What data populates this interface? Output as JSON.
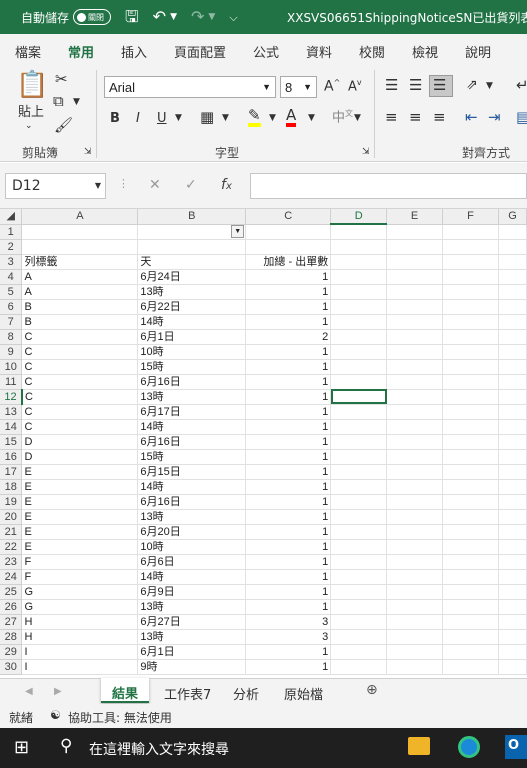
{
  "titlebar": {
    "autosave_label": "自動儲存",
    "toggle_state": "關閉",
    "filename": "XXSVS06651ShippingNoticeSN已出貨列表"
  },
  "tabs": [
    "檔案",
    "常用",
    "插入",
    "頁面配置",
    "公式",
    "資料",
    "校閱",
    "檢視",
    "說明"
  ],
  "active_tab": "常用",
  "ribbon": {
    "paste_label": "貼上",
    "clipboard_label": "剪貼簿",
    "font_name": "Arial",
    "font_size": "8",
    "font_group_label": "字型",
    "align_group_label": "對齊方式",
    "bold": "B",
    "italic": "I",
    "underline": "U",
    "highlight_color": "#ffff00",
    "font_color": "#ff0000"
  },
  "formula_bar": {
    "name_box": "D12",
    "formula": ""
  },
  "columns": [
    "A",
    "B",
    "C",
    "D",
    "E",
    "F",
    "G"
  ],
  "selected_cell": "D12",
  "rows": [
    {
      "r": "1",
      "a": "",
      "b": "",
      "c": ""
    },
    {
      "r": "2",
      "a": "",
      "b": "",
      "c": ""
    },
    {
      "r": "3",
      "a": "列標籤",
      "b": "天",
      "c": "加總 - 出單數"
    },
    {
      "r": "4",
      "a": "A",
      "b": "6月24日",
      "c": "1"
    },
    {
      "r": "5",
      "a": "A",
      "b": "13時",
      "c": "1"
    },
    {
      "r": "6",
      "a": "B",
      "b": "6月22日",
      "c": "1"
    },
    {
      "r": "7",
      "a": "B",
      "b": "14時",
      "c": "1"
    },
    {
      "r": "8",
      "a": "C",
      "b": "6月1日",
      "c": "2"
    },
    {
      "r": "9",
      "a": "C",
      "b": "10時",
      "c": "1"
    },
    {
      "r": "10",
      "a": "C",
      "b": "15時",
      "c": "1"
    },
    {
      "r": "11",
      "a": "C",
      "b": "6月16日",
      "c": "1"
    },
    {
      "r": "12",
      "a": "C",
      "b": "13時",
      "c": "1"
    },
    {
      "r": "13",
      "a": "C",
      "b": "6月17日",
      "c": "1"
    },
    {
      "r": "14",
      "a": "C",
      "b": "14時",
      "c": "1"
    },
    {
      "r": "15",
      "a": "D",
      "b": "6月16日",
      "c": "1"
    },
    {
      "r": "16",
      "a": "D",
      "b": "15時",
      "c": "1"
    },
    {
      "r": "17",
      "a": "E",
      "b": "6月15日",
      "c": "1"
    },
    {
      "r": "18",
      "a": "E",
      "b": "14時",
      "c": "1"
    },
    {
      "r": "19",
      "a": "E",
      "b": "6月16日",
      "c": "1"
    },
    {
      "r": "20",
      "a": "E",
      "b": "13時",
      "c": "1"
    },
    {
      "r": "21",
      "a": "E",
      "b": "6月20日",
      "c": "1"
    },
    {
      "r": "22",
      "a": "E",
      "b": "10時",
      "c": "1"
    },
    {
      "r": "23",
      "a": "F",
      "b": "6月6日",
      "c": "1"
    },
    {
      "r": "24",
      "a": "F",
      "b": "14時",
      "c": "1"
    },
    {
      "r": "25",
      "a": "G",
      "b": "6月9日",
      "c": "1"
    },
    {
      "r": "26",
      "a": "G",
      "b": "13時",
      "c": "1"
    },
    {
      "r": "27",
      "a": "H",
      "b": "6月27日",
      "c": "3"
    },
    {
      "r": "28",
      "a": "H",
      "b": "13時",
      "c": "3"
    },
    {
      "r": "29",
      "a": "I",
      "b": "6月1日",
      "c": "1"
    },
    {
      "r": "30",
      "a": "I",
      "b": "9時",
      "c": "1"
    }
  ],
  "sheets": [
    "結果",
    "工作表7",
    "分析",
    "原始檔"
  ],
  "active_sheet": "結果",
  "status": {
    "ready": "就緒",
    "accessibility": "協助工具: 無法使用"
  },
  "taskbar": {
    "search_placeholder": "在這裡輸入文字來搜尋"
  }
}
